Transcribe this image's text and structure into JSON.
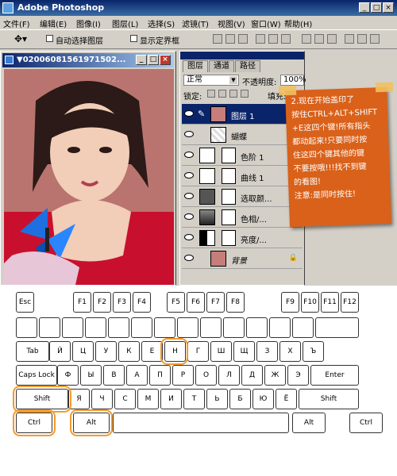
{
  "app": {
    "title": "Adobe Photoshop"
  },
  "menu": [
    "文件(F)",
    "编辑(E)",
    "图像(I)",
    "图层(L)",
    "选择(S)",
    "滤镜(T)",
    "视图(V)",
    "窗口(W)",
    "帮助(H)"
  ],
  "options": {
    "auto_select": "自动选择图层",
    "show_bounds": "显示定界框"
  },
  "document": {
    "title": "▼0200608156197150​2..."
  },
  "layers_panel": {
    "tabs": [
      "图层",
      "通道",
      "路径"
    ],
    "blend_mode": "正常",
    "opacity_label": "不透明度:",
    "opacity_value": "100%",
    "lock_label": "锁定:",
    "fill_label": "填充:",
    "layers": [
      {
        "name": "图层 1",
        "active": true
      },
      {
        "name": "蝴蝶",
        "active": false
      },
      {
        "name": "色阶 1",
        "active": false
      },
      {
        "name": "曲线 1",
        "active": false
      },
      {
        "name": "选取颜...",
        "active": false
      },
      {
        "name": "色相/...",
        "active": false
      },
      {
        "name": "亮度/...",
        "active": false
      },
      {
        "name": "背景",
        "active": false
      }
    ]
  },
  "callout": {
    "lines": [
      "2.现在开始盖印了",
      "按住CTRL+ALT+SHIFT",
      "+E这四个键!所有指头",
      "都动起来!只要同时按",
      "住这四个键其他的键",
      "不要按哦!!!找不到键",
      "的看图!",
      "注意:是同时按住!"
    ]
  },
  "keyboard": {
    "fn_row": [
      "Esc",
      "F1",
      "F2",
      "F3",
      "F4",
      "F5",
      "F6",
      "F7",
      "F8",
      "F9",
      "F10",
      "F11",
      "F12"
    ],
    "row_q": [
      "Tab",
      "Й",
      "Ц",
      "У",
      "К",
      "Е",
      "Н",
      "Г",
      "Ш",
      "Щ",
      "З",
      "Х",
      "Ъ"
    ],
    "row_a": [
      "Caps Lock",
      "Ф",
      "Ы",
      "В",
      "А",
      "П",
      "Р",
      "О",
      "Л",
      "Д",
      "Ж",
      "Э",
      "Enter"
    ],
    "row_z": [
      "Shift",
      "Я",
      "Ч",
      "С",
      "М",
      "И",
      "Т",
      "Ь",
      "Б",
      "Ю",
      "Ё",
      "Shift"
    ],
    "row_space": [
      "Ctrl",
      "Alt",
      "Alt",
      "Ctrl"
    ],
    "highlight_color": "#f59a2b"
  }
}
